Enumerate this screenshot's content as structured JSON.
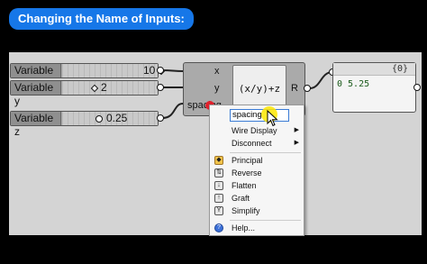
{
  "title": "Changing the Name of Inputs:",
  "sliders": [
    {
      "label": "Variable x",
      "value": "10",
      "knob": "diamond"
    },
    {
      "label": "Variable y",
      "value": "2",
      "knob": "diamond"
    },
    {
      "label": "Variable z",
      "value": "0.25",
      "knob": "circle"
    }
  ],
  "expression_component": {
    "inputs": [
      "x",
      "y",
      "spacing"
    ],
    "expression": "(x/y)+z",
    "output": "R"
  },
  "panel": {
    "header": "{0}",
    "line": "0 5.25"
  },
  "context_menu": {
    "name_field_value": "spacing",
    "items": [
      {
        "label": "Wire Display",
        "submenu": true,
        "icon": ""
      },
      {
        "label": "Disconnect",
        "submenu": true,
        "icon": ""
      },
      {
        "label": "Principal",
        "submenu": false,
        "icon": "principal-icon"
      },
      {
        "label": "Reverse",
        "submenu": false,
        "icon": "reverse-icon"
      },
      {
        "label": "Flatten",
        "submenu": false,
        "icon": "flatten-icon"
      },
      {
        "label": "Graft",
        "submenu": false,
        "icon": "graft-icon"
      },
      {
        "label": "Simplify",
        "submenu": false,
        "icon": "simplify-icon"
      },
      {
        "label": "Help...",
        "submenu": false,
        "icon": "help-icon"
      }
    ]
  },
  "colors": {
    "title_bg": "#1677e8",
    "canvas_bg": "#d4d4d4",
    "cursor_highlight": "#ffe600",
    "input_marker": "#e0212c"
  }
}
